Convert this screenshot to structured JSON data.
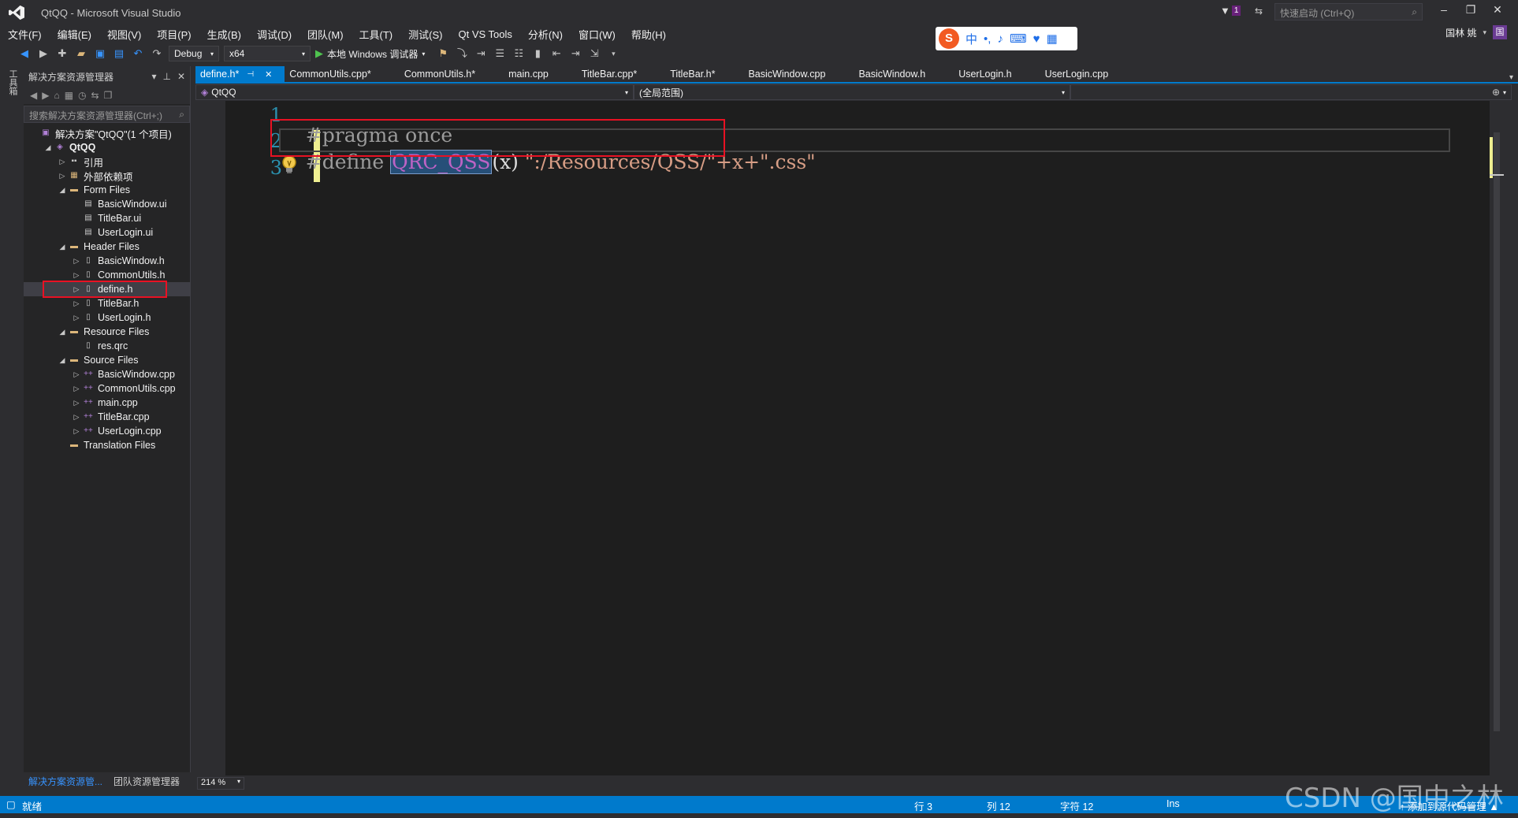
{
  "window": {
    "title": "QtQQ - Microsoft Visual Studio",
    "notification_count": "1",
    "quick_launch_placeholder": "快速启动 (Ctrl+Q)",
    "user_name": "国林 姚",
    "user_initial": "国"
  },
  "menu": [
    "文件(F)",
    "编辑(E)",
    "视图(V)",
    "项目(P)",
    "生成(B)",
    "调试(D)",
    "团队(M)",
    "工具(T)",
    "测试(S)",
    "Qt VS Tools",
    "分析(N)",
    "窗口(W)",
    "帮助(H)"
  ],
  "ime": {
    "chinese_label": "中",
    "punct_label": "•,"
  },
  "toolbar": {
    "configuration": "Debug",
    "platform": "x64",
    "run_label": "本地 Windows 调试器"
  },
  "left_strip": {
    "toolbox_label": "工具箱"
  },
  "solution_explorer": {
    "title": "解决方案资源管理器",
    "search_placeholder": "搜索解决方案资源管理器(Ctrl+;)",
    "tree": [
      {
        "label": "解决方案\"QtQQ\"(1 个项目)",
        "depth": 0,
        "arrow": "",
        "icon": "solution-icon",
        "kind": "sol",
        "glyph": "▣",
        "bold": false
      },
      {
        "label": "QtQQ",
        "depth": 1,
        "arrow": "◢",
        "icon": "project-icon",
        "kind": "sol",
        "glyph": "◈",
        "bold": true
      },
      {
        "label": "引用",
        "depth": 2,
        "arrow": "▷",
        "icon": "references-icon",
        "kind": "ref",
        "glyph": "▪▪",
        "bold": false
      },
      {
        "label": "外部依赖项",
        "depth": 2,
        "arrow": "▷",
        "icon": "external-deps-icon",
        "kind": "folder",
        "glyph": "▦",
        "bold": false
      },
      {
        "label": "Form Files",
        "depth": 2,
        "arrow": "◢",
        "icon": "folder-icon",
        "kind": "folder",
        "glyph": "▬",
        "bold": false
      },
      {
        "label": "BasicWindow.ui",
        "depth": 3,
        "arrow": "",
        "icon": "ui-file-icon",
        "kind": "file",
        "glyph": "▤",
        "bold": false
      },
      {
        "label": "TitleBar.ui",
        "depth": 3,
        "arrow": "",
        "icon": "ui-file-icon",
        "kind": "file",
        "glyph": "▤",
        "bold": false
      },
      {
        "label": "UserLogin.ui",
        "depth": 3,
        "arrow": "",
        "icon": "ui-file-icon",
        "kind": "file",
        "glyph": "▤",
        "bold": false
      },
      {
        "label": "Header Files",
        "depth": 2,
        "arrow": "◢",
        "icon": "folder-icon",
        "kind": "folder",
        "glyph": "▬",
        "bold": false
      },
      {
        "label": "BasicWindow.h",
        "depth": 3,
        "arrow": "▷",
        "icon": "header-file-icon",
        "kind": "file",
        "glyph": "▯",
        "bold": false
      },
      {
        "label": "CommonUtils.h",
        "depth": 3,
        "arrow": "▷",
        "icon": "header-file-icon",
        "kind": "file",
        "glyph": "▯",
        "bold": false
      },
      {
        "label": "define.h",
        "depth": 3,
        "arrow": "▷",
        "icon": "header-file-icon",
        "kind": "file",
        "glyph": "▯",
        "bold": false,
        "selected": true
      },
      {
        "label": "TitleBar.h",
        "depth": 3,
        "arrow": "▷",
        "icon": "header-file-icon",
        "kind": "file",
        "glyph": "▯",
        "bold": false
      },
      {
        "label": "UserLogin.h",
        "depth": 3,
        "arrow": "▷",
        "icon": "header-file-icon",
        "kind": "file",
        "glyph": "▯",
        "bold": false
      },
      {
        "label": "Resource Files",
        "depth": 2,
        "arrow": "◢",
        "icon": "folder-icon",
        "kind": "folder",
        "glyph": "▬",
        "bold": false
      },
      {
        "label": "res.qrc",
        "depth": 3,
        "arrow": "",
        "icon": "resource-file-icon",
        "kind": "file",
        "glyph": "▯",
        "bold": false
      },
      {
        "label": "Source Files",
        "depth": 2,
        "arrow": "◢",
        "icon": "folder-icon",
        "kind": "folder",
        "glyph": "▬",
        "bold": false
      },
      {
        "label": "BasicWindow.cpp",
        "depth": 3,
        "arrow": "▷",
        "icon": "cpp-file-icon",
        "kind": "cpp",
        "glyph": "++",
        "bold": false
      },
      {
        "label": "CommonUtils.cpp",
        "depth": 3,
        "arrow": "▷",
        "icon": "cpp-file-icon",
        "kind": "cpp",
        "glyph": "++",
        "bold": false
      },
      {
        "label": "main.cpp",
        "depth": 3,
        "arrow": "▷",
        "icon": "cpp-file-icon",
        "kind": "cpp",
        "glyph": "++",
        "bold": false
      },
      {
        "label": "TitleBar.cpp",
        "depth": 3,
        "arrow": "▷",
        "icon": "cpp-file-icon",
        "kind": "cpp",
        "glyph": "++",
        "bold": false
      },
      {
        "label": "UserLogin.cpp",
        "depth": 3,
        "arrow": "▷",
        "icon": "cpp-file-icon",
        "kind": "cpp",
        "glyph": "++",
        "bold": false
      },
      {
        "label": "Translation Files",
        "depth": 2,
        "arrow": "",
        "icon": "folder-icon",
        "kind": "folder",
        "glyph": "▬",
        "bold": false
      }
    ],
    "footer_tabs": [
      "解决方案资源管...",
      "团队资源管理器"
    ]
  },
  "tabs": [
    {
      "label": "define.h*",
      "active": true
    },
    {
      "label": "CommonUtils.cpp*",
      "active": false
    },
    {
      "label": "CommonUtils.h*",
      "active": false
    },
    {
      "label": "main.cpp",
      "active": false
    },
    {
      "label": "TitleBar.cpp*",
      "active": false
    },
    {
      "label": "TitleBar.h*",
      "active": false
    },
    {
      "label": "BasicWindow.cpp",
      "active": false
    },
    {
      "label": "BasicWindow.h",
      "active": false
    },
    {
      "label": "UserLogin.h",
      "active": false
    },
    {
      "label": "UserLogin.cpp",
      "active": false
    }
  ],
  "navbar": {
    "project": "QtQQ",
    "scope": "(全局范围)"
  },
  "editor": {
    "line_numbers": [
      "1",
      "2",
      "3"
    ],
    "line1": "#pragma once",
    "line3_directive": "#define ",
    "line3_macro": "QRC_QSS",
    "line3_param": "(x) ",
    "line3_value": "\":/Resources/QSS/\"+x+\".css\"",
    "zoom": "214 %"
  },
  "status": {
    "ready": "就绪",
    "row": "行 3",
    "col": "列 12",
    "char": "字符 12",
    "mode": "Ins",
    "source_control": "↑ 添加到源代码管理 ▲"
  },
  "watermark": "CSDN @国中之林",
  "colors": {
    "accent": "#007acc",
    "highlight_box": "#e81123",
    "macro": "#bd63c5",
    "string": "#d69d85",
    "line_number": "#2b91af"
  }
}
